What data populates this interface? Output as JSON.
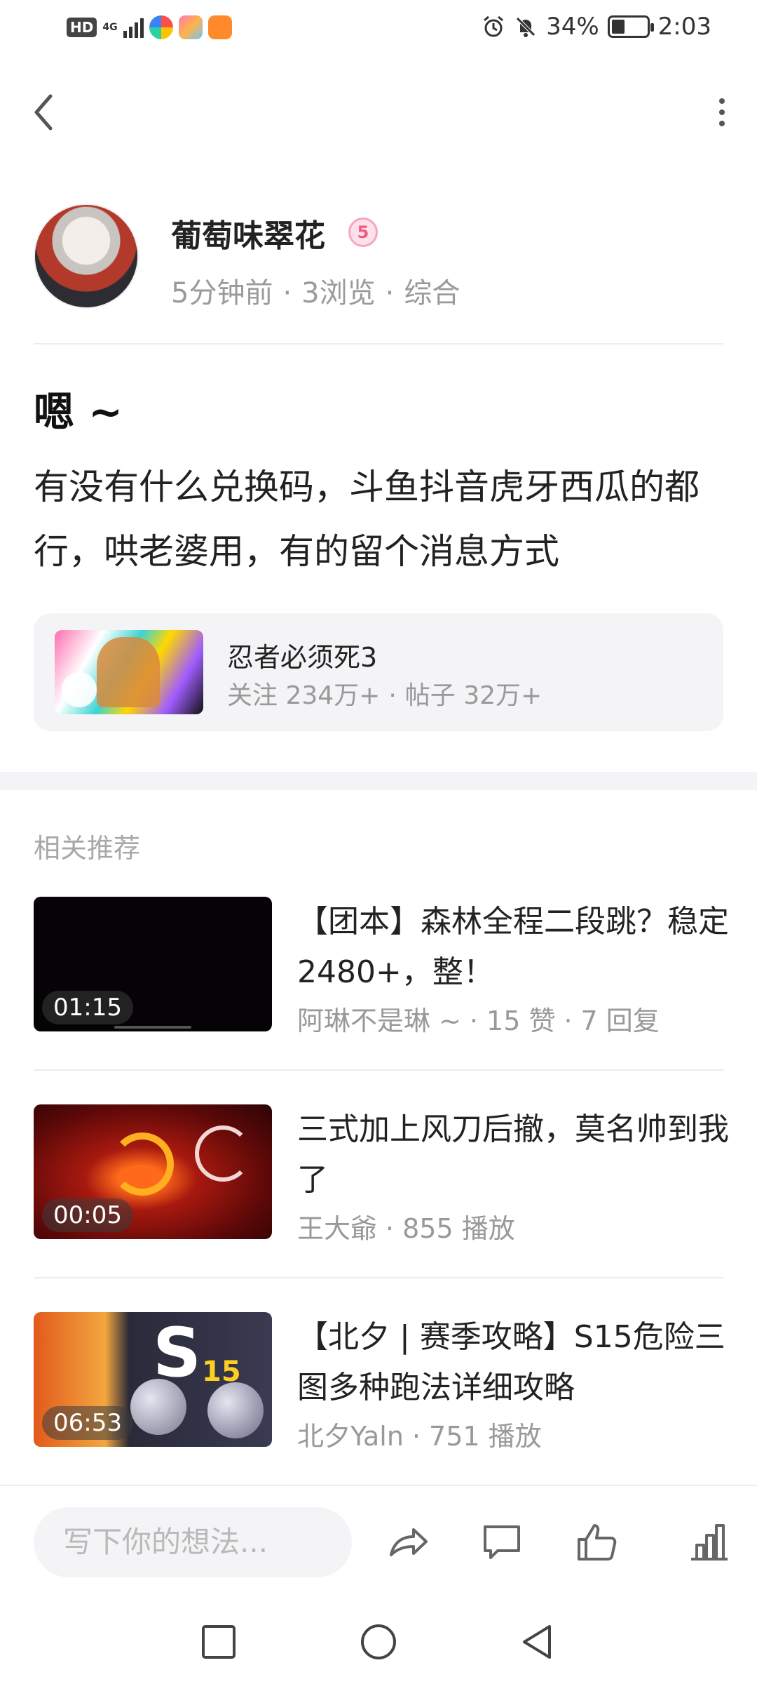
{
  "status_bar": {
    "hd": "HD",
    "network": "4G",
    "battery_text": "34%",
    "battery_level": 0.34,
    "time": "2:03",
    "icons": [
      "hd-icon",
      "signal-icon",
      "app-icon",
      "app-icon",
      "app-icon",
      "alarm-icon",
      "mute-icon",
      "battery-icon"
    ]
  },
  "top_bar": {
    "back_icon": "chevron-left-icon",
    "more_icon": "more-vertical-icon"
  },
  "author": {
    "name": "葡萄味翠花",
    "badge": "5",
    "time": "5分钟前",
    "views": "3浏览",
    "category": "综合"
  },
  "post": {
    "title": "嗯 ~",
    "body": "有没有什么兑换码，斗鱼抖音虎牙西瓜的都行，哄老婆用，有的留个消息方式"
  },
  "game_card": {
    "name": "忍者必须死3",
    "followers": "关注 234万+",
    "posts": "帖子 32万+"
  },
  "recommend": {
    "heading": "相关推荐",
    "items": [
      {
        "duration": "01:15",
        "title": "【团本】森林全程二段跳？稳定2480+，整！",
        "author": "阿琳不是琳 ~",
        "stat1": "15 赞",
        "stat2": "7 回复"
      },
      {
        "duration": "00:05",
        "title": "三式加上风刀后撤，莫名帅到我了",
        "author": "王大爺",
        "stat1": "855 播放"
      },
      {
        "duration": "06:53",
        "title": "【北夕 | 赛季攻略】S15危险三图多种跑法详细攻略",
        "author": "北夕Yaln",
        "stat1": "751 播放",
        "thumb_text_s": "S",
        "thumb_text_15": "15"
      }
    ]
  },
  "action_bar": {
    "placeholder": "写下你的想法...",
    "icons": [
      "share-icon",
      "comment-icon",
      "like-icon",
      "stats-icon"
    ]
  },
  "nav": {
    "icons": [
      "recent-apps-icon",
      "home-icon",
      "back-icon"
    ]
  }
}
